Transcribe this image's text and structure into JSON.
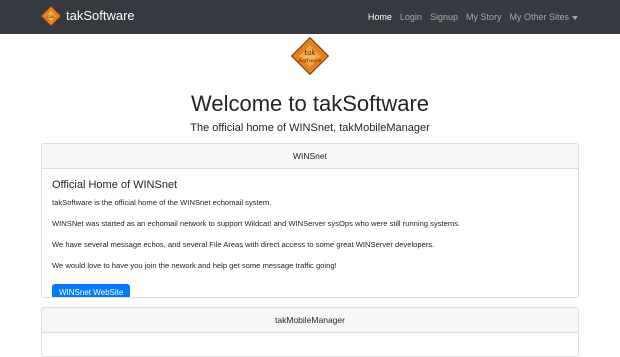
{
  "navbar": {
    "brand": "takSoftware",
    "links": [
      {
        "label": "Home",
        "active": true
      },
      {
        "label": "Login",
        "active": false
      },
      {
        "label": "Signup",
        "active": false
      },
      {
        "label": "My Story",
        "active": false
      },
      {
        "label": "My Other Sites",
        "active": false
      }
    ],
    "background_color": "#343a40"
  },
  "hero": {
    "title": "Welcome to takSoftware",
    "subtitle": "The official home of WINSnet, takMobileManager"
  },
  "cards": {
    "winsnet": {
      "header": "WINSnet",
      "title": "Official Home of WINSnet",
      "paragraphs": [
        "takSoftware is the official home of the WINSnet echomail system.",
        "WINSNet was started as an echomail network to support Wildcat! and WINServer sysOps who were still running systems.",
        "We have several message echos, and several File Areas with direct access to some great WINServer developers.",
        "We would love to have you join the nework and help get some message traffic going!"
      ],
      "button": "WINSnet WebSite",
      "button_color": "#007bff"
    },
    "takmobilemanager": {
      "header": "takMobileManager"
    }
  }
}
